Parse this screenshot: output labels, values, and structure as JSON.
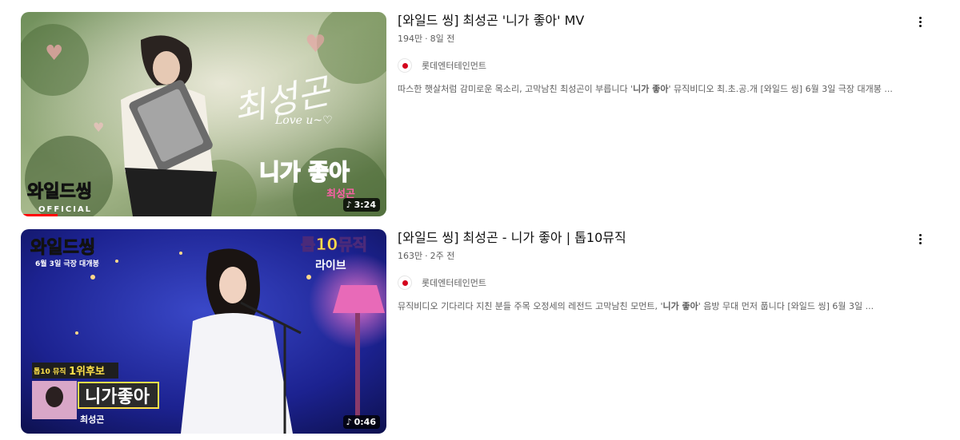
{
  "videos": [
    {
      "title": "[와일드 씽] 최성곤 '니가 좋아' MV",
      "views": "194만",
      "age": "8일 전",
      "channel": "롯데엔터테인먼트",
      "desc_pre": "따스한 햇살처럼 감미로운 목소리, 고막남친 최성곤이 부릅니다 '",
      "desc_bold": "니가 좋아",
      "desc_post": "' 뮤직비디오 최.초.공.개 [와일드 씽] 6월 3일 극장 대개봉 ...",
      "duration": "3:24",
      "watched_fraction": 0.1,
      "thumb": {
        "logo": "와일드씽",
        "logo_sub": "OFFICIAL",
        "script": "최성곤",
        "script_sub": "Love u~♡",
        "song": "니가 좋아",
        "singer": "최성곤"
      }
    },
    {
      "title": "[와일드 씽] 최성곤 - 니가 좋아 | 톱10뮤직",
      "views": "163만",
      "age": "2주 전",
      "channel": "롯데엔터테인먼트",
      "desc_pre": "뮤직비디오 기다리다 지친 분들 주목 오정세의 레전드 고막남친 모먼트, '",
      "desc_bold": "니가 좋아",
      "desc_post": "' 음방 무대 먼저 풉니다 [와일드 씽] 6월 3일 ...",
      "duration": "0:46",
      "watched_fraction": 0,
      "thumb": {
        "logo": "와일드씽",
        "release": "6월 3일 극장 대개봉",
        "show": "톱10뮤직",
        "live": "라이브",
        "badge_small": "톱10 뮤직",
        "badge": "1위후보",
        "song": "니가좋아",
        "singer": "최성곤"
      }
    }
  ],
  "colors": {
    "accent": "#ff0000",
    "text": "#0f0f0f",
    "meta": "#606060"
  },
  "icons": {
    "more": "more-vert-icon",
    "music": "music-note-icon"
  }
}
